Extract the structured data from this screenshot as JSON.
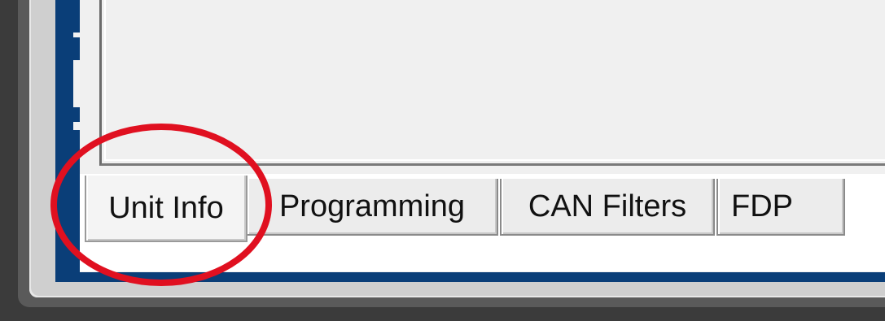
{
  "tabs": [
    {
      "label": "Unit Info",
      "active": true
    },
    {
      "label": "Programming",
      "active": false
    },
    {
      "label": "CAN Filters",
      "active": false
    },
    {
      "label": "FDP",
      "active": false
    }
  ],
  "annotation": {
    "shape": "ellipse",
    "color": "#e01020",
    "target": "Unit Info"
  },
  "colors": {
    "frame": "#0a3e78",
    "panel": "#f0f0f0",
    "chrome": "#3b3b3b"
  }
}
